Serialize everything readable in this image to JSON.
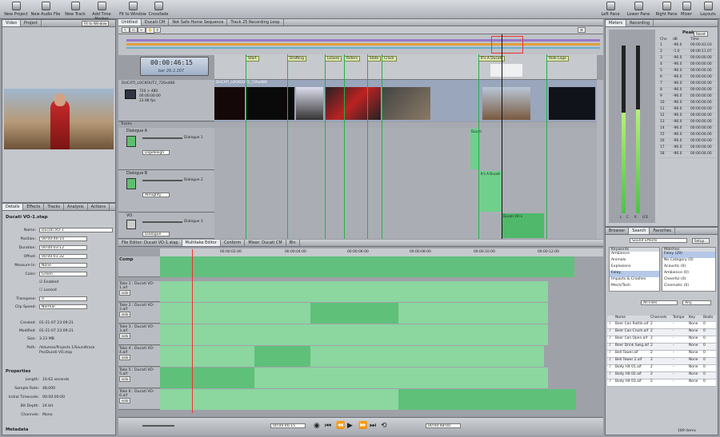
{
  "toolbar": {
    "left": [
      "New Project",
      "New Audio File",
      "New Track",
      "Add Time Marker",
      "Fit to Window",
      "Crossfade"
    ],
    "right": [
      "Left Pane",
      "Lower Pane",
      "Right Pane",
      "Mixer",
      "Layouts"
    ]
  },
  "video": {
    "tabs": [
      "Video",
      "Project"
    ],
    "fit": "Fit to Window"
  },
  "inspector": {
    "tabs": [
      "Details",
      "Effects",
      "Tracks",
      "Analysis",
      "Actions"
    ],
    "title": "Ducati VO-1.stap",
    "fields": [
      {
        "label": "Name:",
        "value": "Ducati VO-1"
      },
      {
        "label": "Position:",
        "value": "00:00:46:10"
      },
      {
        "label": "Duration:",
        "value": "00:00:03:12"
      },
      {
        "label": "Offset:",
        "value": "00:00:01:32"
      },
      {
        "label": "Measure In:",
        "value": "None"
      },
      {
        "label": "Color:",
        "value": "Green"
      }
    ],
    "checks": [
      "Enabled",
      "Locked"
    ],
    "transpose_label": "Transpose:",
    "transpose": "0",
    "clip_speed_label": "Clip Speed:",
    "clip_speed": "Normal",
    "meta": [
      {
        "label": "Created:",
        "value": "01-21-07 23:09:21"
      },
      {
        "label": "Modified:",
        "value": "01-21-07 23:09:21"
      },
      {
        "label": "Size:",
        "value": "3.23 MB"
      },
      {
        "label": "Path:",
        "value": "/Volumes/Projects 1/Soundtrack Pro/Ducati VO.stap"
      }
    ],
    "properties_title": "Properties",
    "props": [
      {
        "label": "Length:",
        "value": "10.62 seconds"
      },
      {
        "label": "Sample Rate:",
        "value": "48,000"
      },
      {
        "label": "Initial Timecode:",
        "value": "00:00:00:00"
      },
      {
        "label": "Bit Depth:",
        "value": "24 bit"
      },
      {
        "label": "Channels:",
        "value": "Mono"
      }
    ],
    "metadata_title": "Metadata"
  },
  "doc_tabs": [
    "Untitled",
    "Ducati CM",
    "Not Safe Home Sequence",
    "Track 25 Recording Loop"
  ],
  "timecode": "00:00:46:15",
  "timecode_sub": "bar 26.2.207",
  "markers": [
    "Start",
    "Drafting",
    "Leaves",
    "Riders",
    "Slate",
    "Crack",
    "It's A Ducati",
    "Ride Logo"
  ],
  "video_track": {
    "name": "DUCATI_LOCKOUT2_720x480",
    "info": [
      "720 × 480",
      "00:00:00:00",
      "23.98 fps"
    ],
    "clip_label": "DUCATI_LOCKOUT2_720x480"
  },
  "sub_title": "Tracks",
  "tracks": [
    {
      "name": "Dialogue A",
      "preset": "Dialogue 1",
      "mode": "Digidesign",
      "clip": "Ducati"
    },
    {
      "name": "Dialogue B",
      "preset": "Dialogue 2",
      "mode": "Almighty",
      "clip": "It's A Ducati"
    },
    {
      "name": "VO",
      "preset": "Dialogue 3",
      "mode": "Dialogue",
      "clip": "Ducati VO-1"
    }
  ],
  "lower_tabs": [
    "File Editor: Ducati VO-1.stap",
    "Multitake Editor",
    "Conform",
    "Mixer: Ducati CM",
    "Bin"
  ],
  "ruler": [
    "00:00:02:00",
    "00:00:04:00",
    "00:00:06:00",
    "00:00:08:00",
    "00:00:10:00",
    "00:00:12:00"
  ],
  "comp_label": "Comp",
  "solo": "solo",
  "takes": [
    "Take 1 : Ducati VO-1.aif",
    "Take 2 : Ducati VO-2.aif",
    "Take 3 : Ducati VO-3.aif",
    "Take 4 : Ducati VO-4.aif",
    "Take 5 : Ducati VO-5.aif",
    "Take 6 : Ducati VO-6.aif"
  ],
  "transport": {
    "left": "00:00:46:15",
    "right": "00:00:48:00"
  },
  "meters": {
    "tabs": [
      "Meters",
      "Recording"
    ],
    "peaks_title": "Peaks",
    "reset": "Reset",
    "peak_cols": [
      "Chn",
      "dB",
      "Time"
    ],
    "peaks": [
      [
        "1",
        "-96.0",
        "00:00:43.03"
      ],
      [
        "2",
        "-1.0",
        "00:00:11.07"
      ],
      [
        "3",
        "-96.0",
        "00:00:00.00"
      ],
      [
        "4",
        "-96.0",
        "00:00:00.00"
      ],
      [
        "5",
        "-96.0",
        "00:00:00.00"
      ],
      [
        "6",
        "-96.0",
        "00:00:00.00"
      ],
      [
        "7",
        "-96.0",
        "00:00:00.00"
      ],
      [
        "8",
        "-96.0",
        "00:00:00.00"
      ],
      [
        "9",
        "-96.0",
        "00:00:00.00"
      ],
      [
        "10",
        "-96.0",
        "00:00:00.00"
      ],
      [
        "11",
        "-96.0",
        "00:00:00.00"
      ],
      [
        "12",
        "-96.0",
        "00:00:00.00"
      ],
      [
        "13",
        "-96.0",
        "00:00:00.00"
      ],
      [
        "14",
        "-96.0",
        "00:00:00.00"
      ],
      [
        "15",
        "-96.0",
        "00:00:00.00"
      ],
      [
        "16",
        "-96.0",
        "00:00:00.00"
      ],
      [
        "17",
        "-96.0",
        "00:00:00.00"
      ],
      [
        "18",
        "-96.0",
        "00:00:00.00"
      ]
    ],
    "levels": [
      0.6,
      0.62
    ],
    "meter_labels": [
      "L",
      "C",
      "R",
      "LFE"
    ]
  },
  "browser": {
    "tabs": [
      "Browser",
      "Search",
      "Favorites"
    ],
    "dropdown": "Sound Effects",
    "setup": "Setup...",
    "keywords_title": "Keywords",
    "keywords": [
      "Ambience",
      "Animals",
      "Explosions",
      "Foley",
      "Impacts & Crashes",
      "Mech/Tech"
    ],
    "matches_title": "Matches",
    "matches": [
      "Foley (29)",
      "No Category (0)",
      "Acoustic (0)",
      "Ambience (0)",
      "Cheerful (0)",
      "Cinematic (0)"
    ],
    "filter": "All Files",
    "key": "Any",
    "cols": [
      "Name",
      "Channels",
      "Tempo",
      "Key",
      "Beats"
    ],
    "files": [
      {
        "name": "Beer Can Rattle.aif",
        "ch": "2",
        "tempo": "-",
        "key": "None",
        "beats": "0"
      },
      {
        "name": "Beer Can Crush.aif",
        "ch": "2",
        "tempo": "-",
        "key": "None",
        "beats": "0"
      },
      {
        "name": "Beer Can Open.aif",
        "ch": "2",
        "tempo": "-",
        "key": "None",
        "beats": "0"
      },
      {
        "name": "Beer Drink Swig.aif",
        "ch": "2",
        "tempo": "-",
        "key": "None",
        "beats": "0"
      },
      {
        "name": "Bell Tower.aif",
        "ch": "2",
        "tempo": "-",
        "key": "None",
        "beats": "0"
      },
      {
        "name": "Bell Tower 2.aif",
        "ch": "2",
        "tempo": "-",
        "key": "None",
        "beats": "0"
      },
      {
        "name": "Body Hit 01.aif",
        "ch": "2",
        "tempo": "-",
        "key": "None",
        "beats": "0"
      },
      {
        "name": "Body Hit 02.aif",
        "ch": "2",
        "tempo": "-",
        "key": "None",
        "beats": "0"
      },
      {
        "name": "Body Hit 03.aif",
        "ch": "2",
        "tempo": "-",
        "key": "None",
        "beats": "0"
      }
    ],
    "count": "189 items"
  }
}
